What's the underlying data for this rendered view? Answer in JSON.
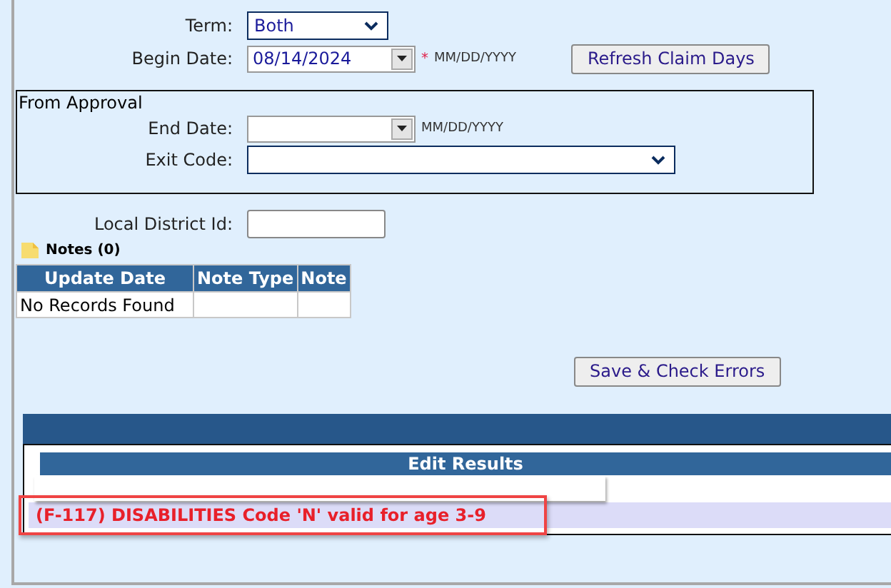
{
  "term": {
    "label": "Term:",
    "value": "Both"
  },
  "begin_date": {
    "label": "Begin Date:",
    "value": "08/14/2024",
    "required_mark": "*",
    "format": "MM/DD/YYYY"
  },
  "refresh_button": "Refresh Claim Days",
  "approval": {
    "legend": "From Approval",
    "end_date": {
      "label": "End Date:",
      "format": "MM/DD/YYYY"
    },
    "exit_code": {
      "label": "Exit Code:"
    }
  },
  "local_district_id": {
    "label": "Local District Id:"
  },
  "notes": {
    "title": "Notes (0)",
    "columns": [
      "Update Date",
      "Note Type",
      "Note"
    ],
    "rows": [
      [
        "No Records Found",
        null,
        null
      ]
    ]
  },
  "save_button": "Save & Check Errors",
  "edit_results": {
    "title": "Edit Results",
    "errors": [
      {
        "text": "(F-117) DISABILITIES Code 'N' valid for age 3-9",
        "highlighted": true
      }
    ]
  }
}
